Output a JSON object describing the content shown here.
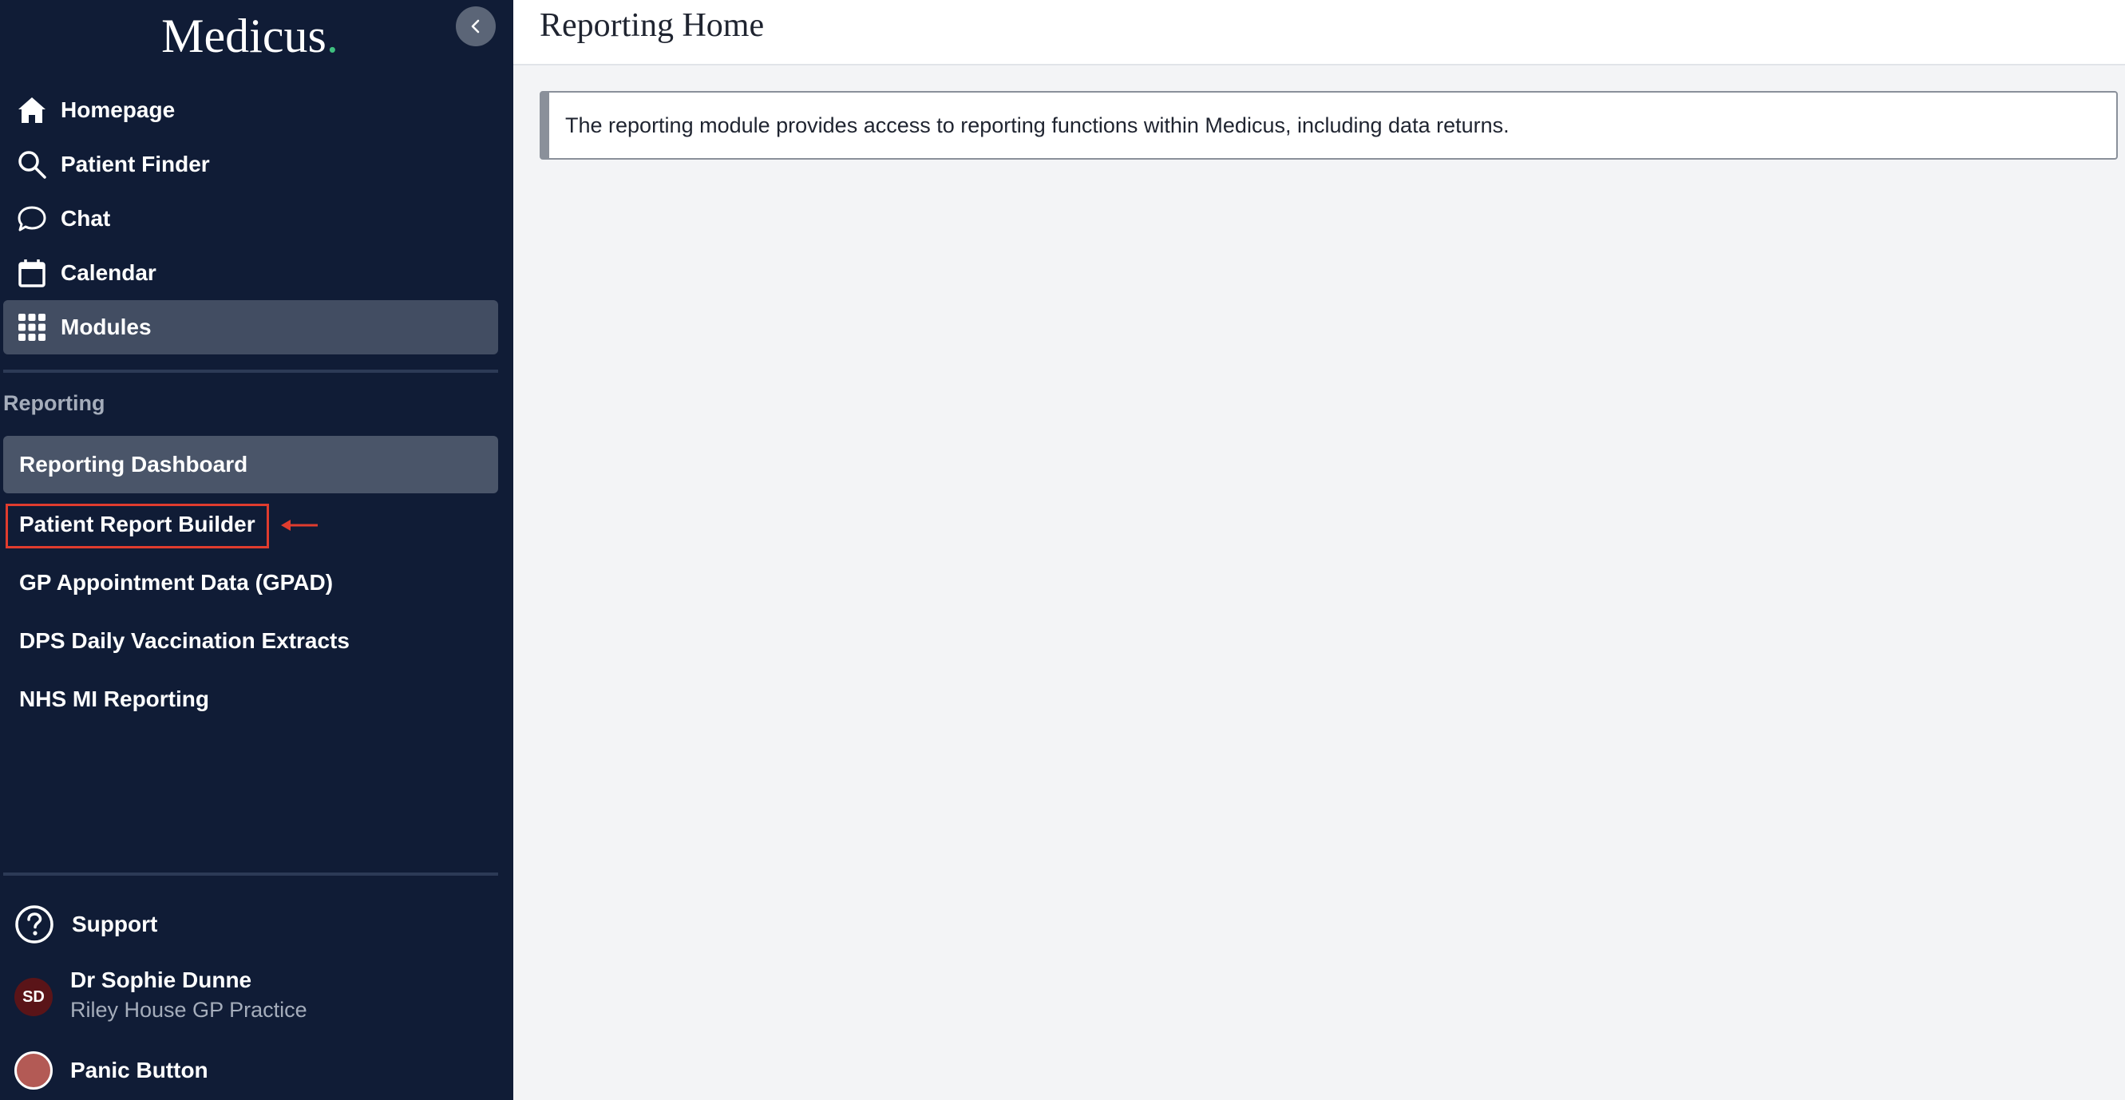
{
  "app": {
    "logo_text": "Medicus",
    "logo_dot": ".",
    "brand_color": "#3fbf7f"
  },
  "sidebar": {
    "collapse_icon": "chevron-left-icon",
    "nav": [
      {
        "label": "Homepage",
        "icon": "home-icon"
      },
      {
        "label": "Patient Finder",
        "icon": "search-icon"
      },
      {
        "label": "Chat",
        "icon": "chat-icon"
      },
      {
        "label": "Calendar",
        "icon": "calendar-icon"
      },
      {
        "label": "Modules",
        "icon": "grid-icon",
        "active": true
      }
    ],
    "section_label": "Reporting",
    "sub_items": [
      {
        "label": "Reporting Dashboard",
        "active": true
      },
      {
        "label": "Patient Report Builder",
        "highlighted": true
      },
      {
        "label": "GP Appointment Data (GPAD)"
      },
      {
        "label": "DPS Daily Vaccination Extracts"
      },
      {
        "label": "NHS MI Reporting"
      }
    ],
    "footer": {
      "support_label": "Support",
      "user_initials": "SD",
      "user_name": "Dr Sophie Dunne",
      "user_practice": "Riley House GP Practice",
      "panic_label": "Panic Button"
    }
  },
  "main": {
    "page_title": "Reporting Home",
    "info_text": "The reporting module provides access to reporting functions within Medicus, including data returns."
  },
  "annotation": {
    "highlight_color": "#e03c2e"
  }
}
